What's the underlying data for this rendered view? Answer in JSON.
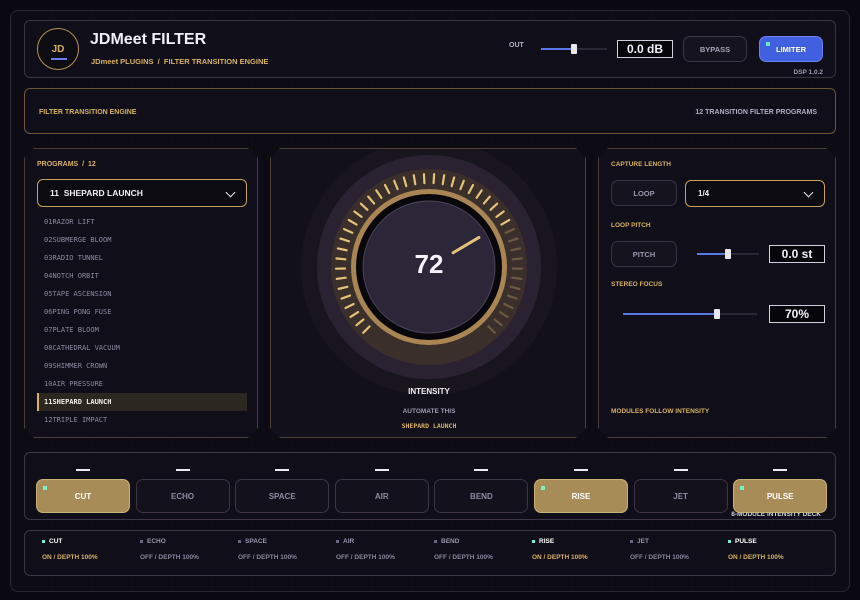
{
  "header": {
    "logo_text": "JD",
    "title": "JDMeet FILTER",
    "subtitle": "JDmeet PLUGINS  /  FILTER TRANSITION ENGINE",
    "out_label": "OUT",
    "out_value": "0.0 dB",
    "out_level": 0.5,
    "bypass_label": "BYPASS",
    "limiter_label": "LIMITER",
    "dsp_version": "DSP 1.0.2"
  },
  "strip": {
    "left_text": "FILTER TRANSITION ENGINE",
    "right_text": "12 TRANSITION FILTER PROGRAMS"
  },
  "programs": {
    "heading": "PROGRAMS  /  12",
    "selected": "11  SHEPARD LAUNCH",
    "items": [
      {
        "num": "01",
        "name": "RAZOR LIFT"
      },
      {
        "num": "02",
        "name": "SUBMERGE BLOOM"
      },
      {
        "num": "03",
        "name": "RADIO TUNNEL"
      },
      {
        "num": "04",
        "name": "NOTCH ORBIT"
      },
      {
        "num": "05",
        "name": "TAPE ASCENSION"
      },
      {
        "num": "06",
        "name": "PING PONG FUSE"
      },
      {
        "num": "07",
        "name": "PLATE BLOOM"
      },
      {
        "num": "08",
        "name": "CATHEDRAL VACUUM"
      },
      {
        "num": "09",
        "name": "SHIMMER CROWN"
      },
      {
        "num": "10",
        "name": "AIR PRESSURE"
      },
      {
        "num": "11",
        "name": "SHEPARD LAUNCH"
      },
      {
        "num": "12",
        "name": "TRIPLE IMPACT"
      }
    ],
    "active_index": 10
  },
  "knob": {
    "value": "72",
    "level": 0.72,
    "label": "INTENSITY",
    "sub_label": "AUTOMATE THIS",
    "program_label": "SHEPARD LAUNCH"
  },
  "capture": {
    "capture_length_label": "CAPTURE LENGTH",
    "loop_button": "LOOP",
    "length_value": "1/4",
    "loop_pitch_label": "LOOP PITCH",
    "pitch_button": "PITCH",
    "pitch_value": "0.0 st",
    "pitch_level": 0.5,
    "stereo_focus_label": "STEREO FOCUS",
    "stereo_value": "70%",
    "stereo_level": 0.7,
    "footer": "MODULES FOLLOW INTENSITY"
  },
  "deck": {
    "caption": "8-MODULE INTENSITY DECK",
    "modules": [
      {
        "name": "CUT",
        "on": true
      },
      {
        "name": "ECHO",
        "on": false
      },
      {
        "name": "SPACE",
        "on": false
      },
      {
        "name": "AIR",
        "on": false
      },
      {
        "name": "BEND",
        "on": false
      },
      {
        "name": "RISE",
        "on": true
      },
      {
        "name": "JET",
        "on": false
      },
      {
        "name": "PULSE",
        "on": true
      }
    ]
  },
  "status": [
    {
      "name": "CUT",
      "value": "ON / DEPTH 100%",
      "on": true
    },
    {
      "name": "ECHO",
      "value": "OFF / DEPTH 100%",
      "on": false
    },
    {
      "name": "SPACE",
      "value": "OFF / DEPTH 100%",
      "on": false
    },
    {
      "name": "AIR",
      "value": "OFF / DEPTH 100%",
      "on": false
    },
    {
      "name": "BEND",
      "value": "OFF / DEPTH 100%",
      "on": false
    },
    {
      "name": "RISE",
      "value": "ON / DEPTH 100%",
      "on": true
    },
    {
      "name": "JET",
      "value": "OFF / DEPTH 100%",
      "on": false
    },
    {
      "name": "PULSE",
      "value": "ON / DEPTH 100%",
      "on": true
    }
  ],
  "colors": {
    "accent_gold": "#d8b265",
    "accent_blue": "#5b78ea",
    "led_green": "#7bf0c8",
    "module_on": "#a88c58"
  }
}
